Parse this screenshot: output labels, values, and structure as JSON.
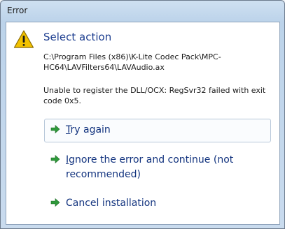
{
  "window": {
    "title": "Error"
  },
  "dialog": {
    "icon": "warning-icon",
    "heading": "Select action",
    "path": "C:\\Program Files (x86)\\K-Lite Codec Pack\\MPC-HC64\\LAVFilters64\\LAVAudio.ax",
    "message": "Unable to register the DLL/OCX: RegSvr32 failed with exit code 0x5."
  },
  "commands": [
    {
      "access_key": "T",
      "rest": "ry again",
      "icon": "green-arrow-icon"
    },
    {
      "access_key": "I",
      "rest": "gnore the error and continue (not recommended)",
      "icon": "green-arrow-icon"
    },
    {
      "access_key": "",
      "rest": "Cancel installation",
      "icon": "green-arrow-icon"
    }
  ],
  "colors": {
    "heading": "#1c3d8f",
    "command_text": "#13347f",
    "arrow": "#2f9a3b",
    "warning": "#f2c200"
  }
}
